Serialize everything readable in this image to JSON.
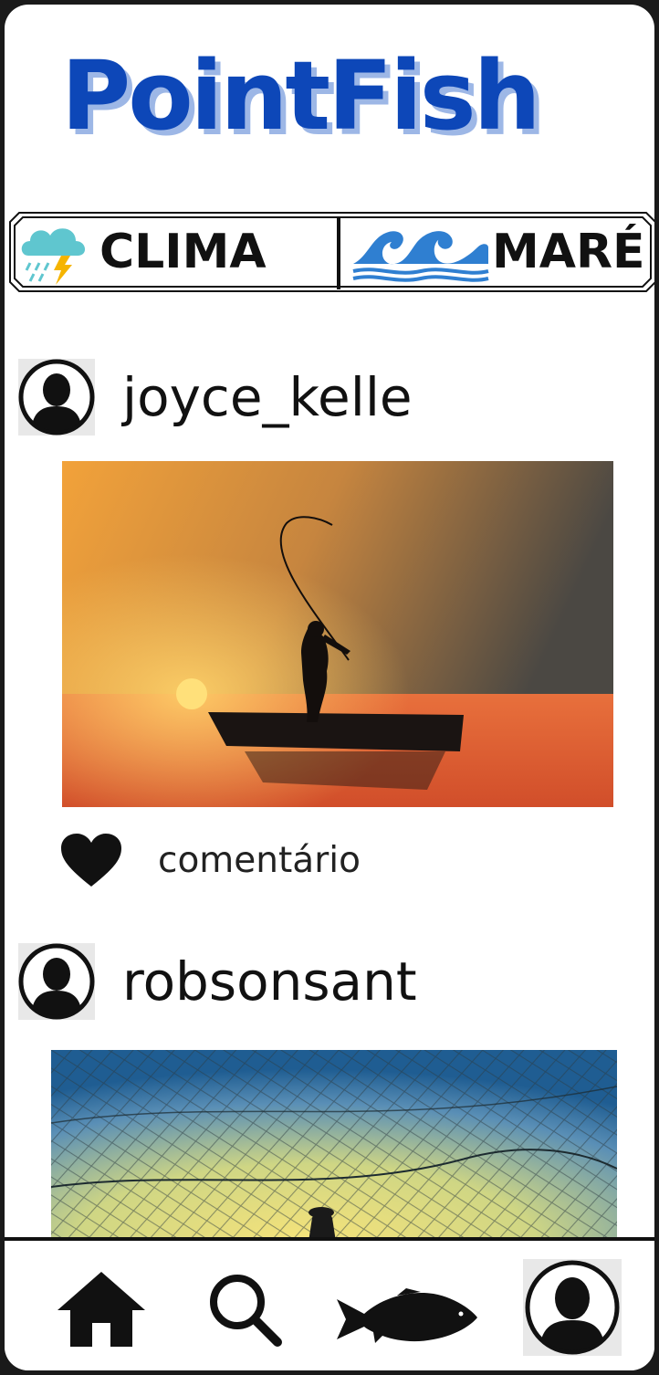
{
  "app": {
    "title": "PointFish"
  },
  "tabs": {
    "clima": {
      "label": "CLIMA",
      "icon": "storm-cloud-icon"
    },
    "mare": {
      "label": "MARÉ",
      "icon": "waves-icon"
    }
  },
  "posts": [
    {
      "username": "joyce_kelle",
      "comment_label": "comentário",
      "image": "fisherman-sunset-photo"
    },
    {
      "username": "robsonsant",
      "image": "fishing-net-photo"
    }
  ],
  "nav": [
    {
      "name": "home",
      "icon": "home-icon"
    },
    {
      "name": "search",
      "icon": "search-icon"
    },
    {
      "name": "fish",
      "icon": "fish-icon"
    },
    {
      "name": "profile",
      "icon": "avatar-icon"
    }
  ],
  "colors": {
    "brand": "#0d47b8",
    "brand_shadow": "#9db7e6",
    "wave": "#2f7fd1",
    "cloud": "#5fc6cf"
  }
}
